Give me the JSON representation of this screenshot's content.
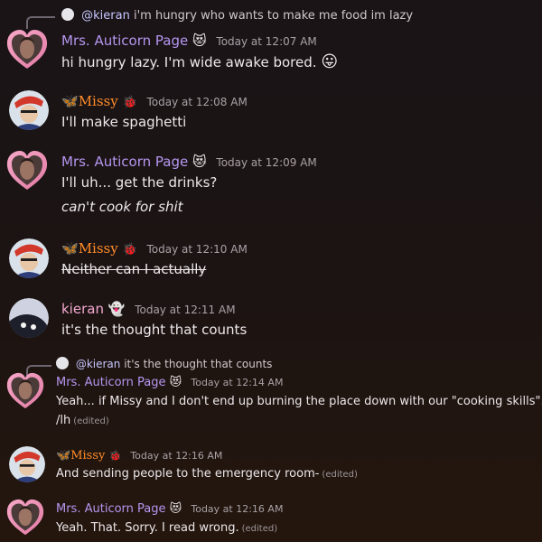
{
  "messages": [
    {
      "reply": {
        "mention": "@kieran",
        "text": "i'm hungry who wants to make me food im lazy"
      },
      "author": "Mrs. Auticorn Page",
      "time": "Today at 12:07 AM",
      "lines": [
        "hi hungry lazy. I'm wide awake bored."
      ],
      "avatar": "heart-avatar",
      "badge": "heart-eyes-cat-emoji",
      "emoji": "tongue-face-emoji"
    },
    {
      "author": "Missy",
      "time": "Today at 12:08 AM",
      "lines": [
        "I'll make spaghetti"
      ],
      "avatar": "round-avatar",
      "badge": "ladybug-emoji",
      "prefix": "butterfly-emoji"
    },
    {
      "author": "Mrs. Auticorn Page",
      "time": "Today at 12:09 AM",
      "lines": [
        "I'll uh... get the drinks?",
        "can't cook for shit"
      ],
      "avatar": "heart-avatar",
      "badge": "heart-eyes-cat-emoji"
    },
    {
      "author": "Missy",
      "time": "Today at 12:10 AM",
      "lines": [
        "Neither can I actually"
      ],
      "avatar": "round-avatar",
      "badge": "ladybug-emoji",
      "prefix": "butterfly-emoji"
    },
    {
      "author": "kieran",
      "time": "Today at 12:11 AM",
      "lines": [
        "it's the thought that counts"
      ],
      "avatar": "round-avatar",
      "badge": "ghost-emoji"
    },
    {
      "reply": {
        "mention": "@kieran",
        "text": "it's the thought that counts"
      },
      "author": "Mrs. Auticorn Page",
      "time": "Today at 12:14 AM",
      "lines": [
        "Yeah... if Missy and I don't end up burning the place down with our \"cooking skills\". /j",
        "/lh"
      ],
      "edited": "(edited)",
      "avatar": "heart-avatar",
      "badge": "heart-eyes-cat-emoji"
    },
    {
      "author": "Missy",
      "time": "Today at 12:16 AM",
      "lines": [
        "And sending people to the emergency room-"
      ],
      "edited": "(edited)",
      "avatar": "round-avatar",
      "badge": "ladybug-emoji",
      "prefix": "butterfly-emoji"
    },
    {
      "author": "Mrs. Auticorn Page",
      "time": "Today at 12:16 AM",
      "lines": [
        "Yeah. That. Sorry. I read wrong."
      ],
      "edited": "(edited)",
      "avatar": "heart-avatar",
      "badge": "heart-eyes-cat-emoji"
    }
  ],
  "colors": {
    "auticorn": "#b596f0",
    "missy": "#ff8c2a",
    "kieran": "#f4a8d0",
    "background": "#1c1412"
  }
}
